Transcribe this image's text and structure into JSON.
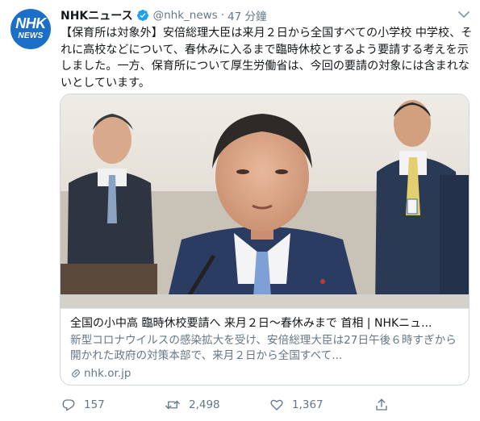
{
  "colors": {
    "text": "#14171a",
    "secondary": "#657786",
    "border": "#ccd6dd",
    "verified": "#1da1f2",
    "avatar_bg": "#1b6fc8"
  },
  "avatar": {
    "line1": "NHK",
    "line2": "NEWS"
  },
  "header": {
    "name": "NHKニュース",
    "handle": "@nhk_news",
    "separator": "·",
    "time": "47 分鐘"
  },
  "tweet": {
    "text": "【保育所は対象外】安倍総理大臣は来月２日から全国すべての小学校 中学校、それに高校などについて、春休みに入るまで臨時休校とするよう要請する考えを示しました。一方、保育所について厚生労働省は、今回の要請の対象には含まれないとしています。"
  },
  "card": {
    "title": "全国の小中高 臨時休校要請へ 来月２日～春休みまで 首相 | NHKニュ...",
    "description": "新型コロナウイルスの感染拡大を受け、安倍総理大臣は27日午後６時すぎから開かれた政府の対策本部で、来月２日から全国すべて...",
    "domain": "nhk.or.jp"
  },
  "actions": {
    "replies": "157",
    "retweets": "2,498",
    "likes": "1,367"
  },
  "icons": [
    "verified-icon",
    "caret-down-icon",
    "link-icon",
    "reply-icon",
    "retweet-icon",
    "like-icon",
    "share-icon"
  ]
}
